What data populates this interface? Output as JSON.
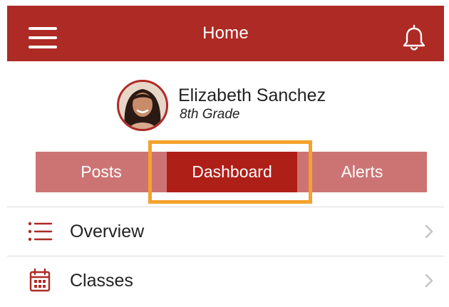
{
  "header": {
    "title": "Home",
    "background": "#ae2a24",
    "menu_icon": "hamburger-menu-icon",
    "notification_icon": "bell-icon"
  },
  "profile": {
    "name": "Elizabeth Sanchez",
    "grade": "8th Grade",
    "avatar_icon": "avatar"
  },
  "tabs": {
    "items": [
      {
        "label": "Posts",
        "selected": false
      },
      {
        "label": "Dashboard",
        "selected": true
      },
      {
        "label": "Alerts",
        "selected": false
      }
    ],
    "highlight_color": "#f4a22d",
    "selected_color": "#ae1f18",
    "unselected_color": "#cc7474"
  },
  "list": {
    "items": [
      {
        "label": "Overview",
        "icon": "list-icon"
      },
      {
        "label": "Classes",
        "icon": "calendar-icon"
      }
    ]
  }
}
